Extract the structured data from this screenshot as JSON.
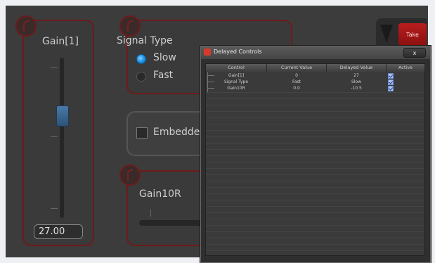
{
  "gain_panel": {
    "title": "Gain[1]",
    "value": "27.00"
  },
  "signal_panel": {
    "title": "Signal Type",
    "options": [
      "Slow",
      "Fast"
    ],
    "selected": "Slow"
  },
  "embed_panel": {
    "label": "Embedder"
  },
  "gain10r_panel": {
    "title": "Gain10R"
  },
  "take_button": {
    "label": "Take"
  },
  "dialog": {
    "title": "Delayed Controls",
    "close_label": "x",
    "columns": [
      "Control",
      "Current Value",
      "Delayed Value",
      "Active"
    ],
    "rows": [
      {
        "control": "Gain[1]",
        "current": "0",
        "delayed": "27"
      },
      {
        "control": "Signal Type",
        "current": "Fast",
        "delayed": "Slow"
      },
      {
        "control": "Gain10R",
        "current": "0.0",
        "delayed": "-10.5"
      }
    ]
  },
  "colors": {
    "accent_red": "#8c1010",
    "panel_border": "#6e1a1a",
    "radio_blue": "#1d8fe0"
  }
}
